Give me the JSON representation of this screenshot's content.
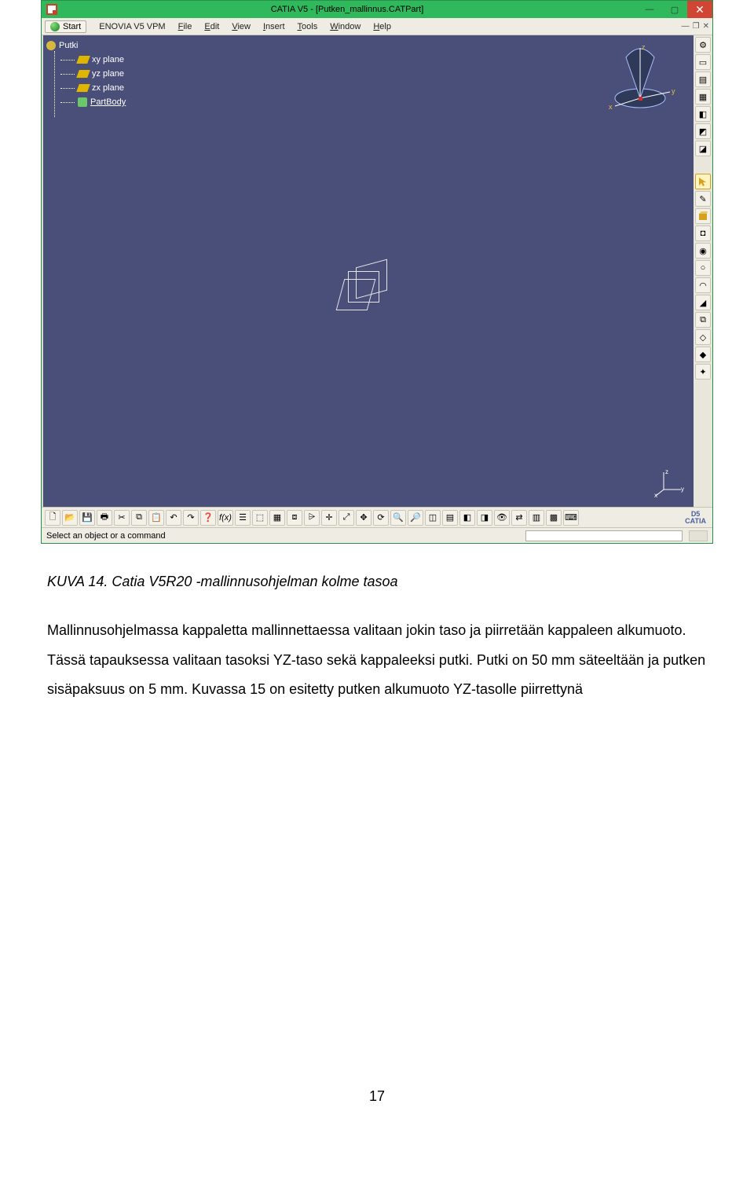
{
  "catia": {
    "title": "CATIA V5 - [Putken_mallinnus.CATPart]",
    "start": "Start",
    "menu": {
      "enovia": "ENOVIA V5 VPM",
      "file": "File",
      "edit": "Edit",
      "view": "View",
      "insert": "Insert",
      "tools": "Tools",
      "window": "Window",
      "help": "Help"
    },
    "tree": {
      "root": "Putki",
      "xy": "xy plane",
      "yz": "yz plane",
      "zx": "zx plane",
      "partbody": "PartBody"
    },
    "compass": {
      "x": "x",
      "y": "y",
      "z": "z"
    },
    "triad": {
      "x": "x",
      "y": "y",
      "z": "z"
    },
    "status": "Select an object or a command",
    "logo": "CATIA"
  },
  "doc": {
    "caption": "KUVA 14. Catia V5R20 -mallinnusohjelman kolme tasoa",
    "body": "Mallinnusohjelmassa kappaletta mallinnettaessa valitaan jokin taso ja piirretään kappaleen alkumuoto. Tässä tapauksessa valitaan tasoksi YZ-taso sekä kappaleeksi putki. Putki on 50 mm säteeltään ja putken sisäpaksuus on 5 mm. Kuvassa 15 on esitetty putken alkumuoto YZ-tasolle piirrettynä",
    "pagenum": "17"
  }
}
